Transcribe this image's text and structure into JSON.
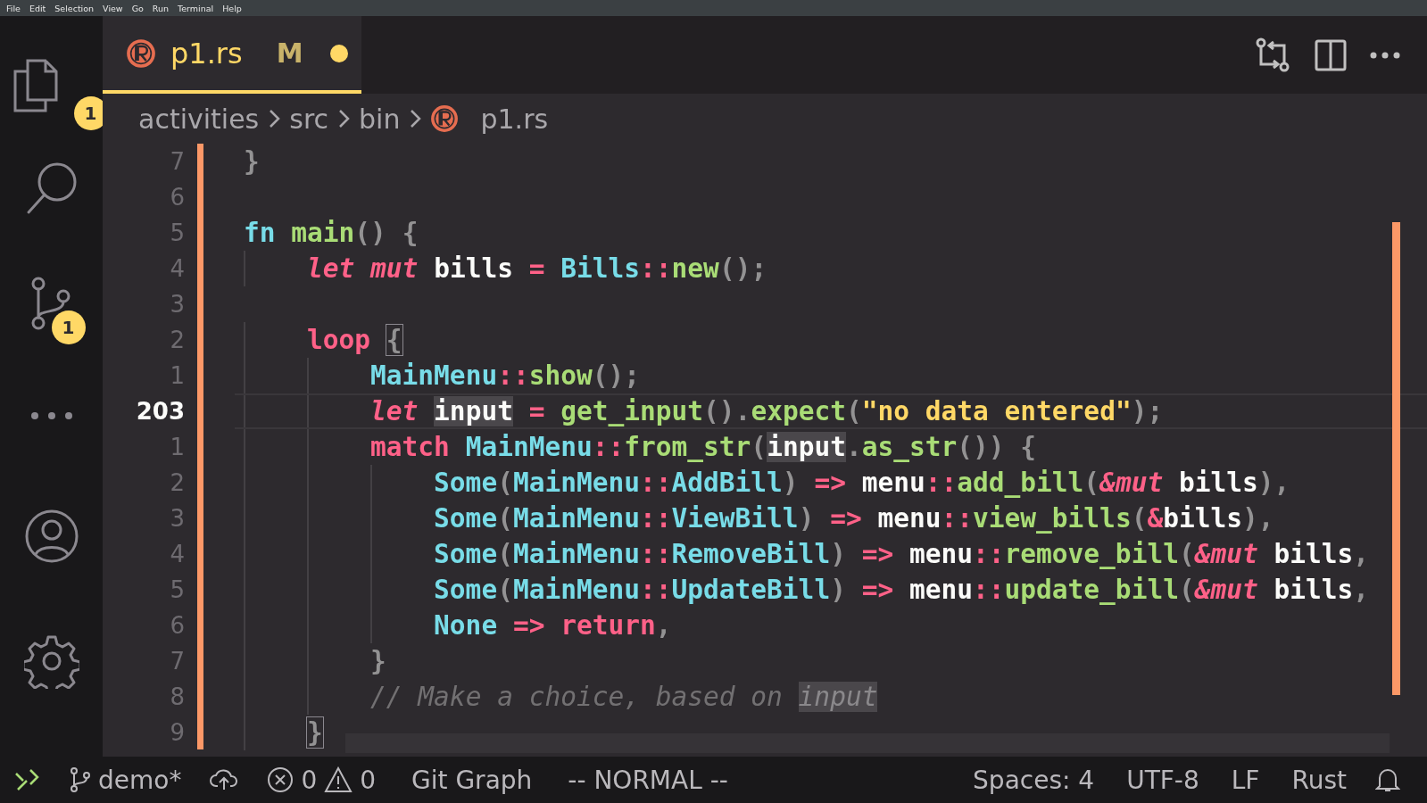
{
  "menu_bar": [
    "File",
    "Edit",
    "Selection",
    "View",
    "Go",
    "Run",
    "Terminal",
    "Help"
  ],
  "activity_bar": [
    {
      "kind": "files",
      "badge": "1",
      "selected": false
    },
    {
      "kind": "search",
      "selected": false
    },
    {
      "kind": "source-control",
      "badge": "1",
      "selected": false
    },
    {
      "kind": "more",
      "selected": false
    },
    {
      "kind": "account",
      "selected": false
    },
    {
      "kind": "settings",
      "selected": false
    }
  ],
  "tab": {
    "label": "p1.rs",
    "status": "M",
    "modified": true,
    "selected": true
  },
  "breadcrumbs": [
    {
      "label": "activities",
      "kind": "folder"
    },
    {
      "label": "src",
      "kind": "folder"
    },
    {
      "label": "bin",
      "kind": "folder"
    },
    {
      "label": "p1.rs",
      "kind": "rust"
    }
  ],
  "editor": {
    "lines": [
      {
        "number": "7",
        "current": false,
        "tokens": [
          {
            "text": "}",
            "kind": "punct"
          }
        ]
      },
      {
        "number": "6",
        "current": false
      },
      {
        "number": "5",
        "current": false,
        "tokens": [
          {
            "text": "fn ",
            "kind": "ty"
          },
          {
            "text": "main",
            "kind": "fn"
          },
          {
            "text": "() {",
            "kind": "punct"
          }
        ]
      },
      {
        "number": "4",
        "current": false,
        "tokens": [
          {
            "text": "    let mut ",
            "kind": "kwi"
          },
          {
            "text": "bills ",
            "kind": "id"
          },
          {
            "text": "= ",
            "kind": "op"
          },
          {
            "text": "Bills",
            "kind": "ty"
          },
          {
            "text": "::",
            "kind": "op"
          },
          {
            "text": "new",
            "kind": "fn"
          },
          {
            "text": "();",
            "kind": "punct"
          }
        ]
      },
      {
        "number": "3",
        "current": false
      },
      {
        "number": "2",
        "current": false,
        "tokens": [
          {
            "text": "    loop ",
            "kind": "kw"
          },
          {
            "text": "{",
            "kind": "bracket"
          }
        ]
      },
      {
        "number": "1",
        "current": false,
        "tokens": [
          {
            "text": "        MainMenu",
            "kind": "ty"
          },
          {
            "text": "::",
            "kind": "op"
          },
          {
            "text": "show",
            "kind": "fn"
          },
          {
            "text": "();",
            "kind": "punct"
          }
        ]
      },
      {
        "number": "203",
        "current": true,
        "tokens": [
          {
            "text": "        let ",
            "kind": "kwi"
          },
          {
            "text": "input",
            "kind": "hl"
          },
          {
            "text": " = ",
            "kind": "op"
          },
          {
            "text": "get_input",
            "kind": "fn"
          },
          {
            "text": "().",
            "kind": "punct"
          },
          {
            "text": "expect",
            "kind": "fn"
          },
          {
            "text": "(",
            "kind": "punct"
          },
          {
            "text": "\"no data entered\"",
            "kind": "str"
          },
          {
            "text": ");",
            "kind": "punct"
          }
        ]
      },
      {
        "number": "1",
        "current": false,
        "tokens": [
          {
            "text": "        match ",
            "kind": "kw"
          },
          {
            "text": "MainMenu",
            "kind": "ty"
          },
          {
            "text": "::",
            "kind": "op"
          },
          {
            "text": "from_str",
            "kind": "fn"
          },
          {
            "text": "(",
            "kind": "punct"
          },
          {
            "text": "input",
            "kind": "hl"
          },
          {
            "text": ".",
            "kind": "punct"
          },
          {
            "text": "as_str",
            "kind": "fn"
          },
          {
            "text": "()) {",
            "kind": "punct"
          }
        ]
      },
      {
        "number": "2",
        "current": false,
        "tokens": [
          {
            "text": "            Some",
            "kind": "ty"
          },
          {
            "text": "(",
            "kind": "punct"
          },
          {
            "text": "MainMenu",
            "kind": "ty"
          },
          {
            "text": "::",
            "kind": "op"
          },
          {
            "text": "AddBill",
            "kind": "ty"
          },
          {
            "text": ") ",
            "kind": "punct"
          },
          {
            "text": "=> ",
            "kind": "op"
          },
          {
            "text": "menu",
            "kind": "id"
          },
          {
            "text": "::",
            "kind": "op"
          },
          {
            "text": "add_bill",
            "kind": "fn"
          },
          {
            "text": "(",
            "kind": "punct"
          },
          {
            "text": "&mut ",
            "kind": "kwi"
          },
          {
            "text": "bills",
            "kind": "id"
          },
          {
            "text": "),",
            "kind": "punct"
          }
        ]
      },
      {
        "number": "3",
        "current": false,
        "tokens": [
          {
            "text": "            Some",
            "kind": "ty"
          },
          {
            "text": "(",
            "kind": "punct"
          },
          {
            "text": "MainMenu",
            "kind": "ty"
          },
          {
            "text": "::",
            "kind": "op"
          },
          {
            "text": "ViewBill",
            "kind": "ty"
          },
          {
            "text": ") ",
            "kind": "punct"
          },
          {
            "text": "=> ",
            "kind": "op"
          },
          {
            "text": "menu",
            "kind": "id"
          },
          {
            "text": "::",
            "kind": "op"
          },
          {
            "text": "view_bills",
            "kind": "fn"
          },
          {
            "text": "(",
            "kind": "punct"
          },
          {
            "text": "&",
            "kind": "op"
          },
          {
            "text": "bills",
            "kind": "id"
          },
          {
            "text": "),",
            "kind": "punct"
          }
        ]
      },
      {
        "number": "4",
        "current": false,
        "tokens": [
          {
            "text": "            Some",
            "kind": "ty"
          },
          {
            "text": "(",
            "kind": "punct"
          },
          {
            "text": "MainMenu",
            "kind": "ty"
          },
          {
            "text": "::",
            "kind": "op"
          },
          {
            "text": "RemoveBill",
            "kind": "ty"
          },
          {
            "text": ") ",
            "kind": "punct"
          },
          {
            "text": "=> ",
            "kind": "op"
          },
          {
            "text": "menu",
            "kind": "id"
          },
          {
            "text": "::",
            "kind": "op"
          },
          {
            "text": "remove_bill",
            "kind": "fn"
          },
          {
            "text": "(",
            "kind": "punct"
          },
          {
            "text": "&mut ",
            "kind": "kwi"
          },
          {
            "text": "bills",
            "kind": "id"
          },
          {
            "text": ",",
            "kind": "punct"
          }
        ]
      },
      {
        "number": "5",
        "current": false,
        "tokens": [
          {
            "text": "            Some",
            "kind": "ty"
          },
          {
            "text": "(",
            "kind": "punct"
          },
          {
            "text": "MainMenu",
            "kind": "ty"
          },
          {
            "text": "::",
            "kind": "op"
          },
          {
            "text": "UpdateBill",
            "kind": "ty"
          },
          {
            "text": ") ",
            "kind": "punct"
          },
          {
            "text": "=> ",
            "kind": "op"
          },
          {
            "text": "menu",
            "kind": "id"
          },
          {
            "text": "::",
            "kind": "op"
          },
          {
            "text": "update_bill",
            "kind": "fn"
          },
          {
            "text": "(",
            "kind": "punct"
          },
          {
            "text": "&mut ",
            "kind": "kwi"
          },
          {
            "text": "bills",
            "kind": "id"
          },
          {
            "text": ",",
            "kind": "punct"
          }
        ]
      },
      {
        "number": "6",
        "current": false,
        "tokens": [
          {
            "text": "            None ",
            "kind": "ty"
          },
          {
            "text": "=> ",
            "kind": "op"
          },
          {
            "text": "return",
            "kind": "kw"
          },
          {
            "text": ",",
            "kind": "punct"
          }
        ]
      },
      {
        "number": "7",
        "current": false,
        "tokens": [
          {
            "text": "        }",
            "kind": "punct"
          }
        ]
      },
      {
        "number": "8",
        "current": false,
        "tokens": [
          {
            "text": "        // Make a choice, based on ",
            "kind": "cmt"
          },
          {
            "text": "input",
            "kind": "cmthl"
          }
        ]
      },
      {
        "number": "9",
        "current": false,
        "tokens": [
          {
            "text": "    }",
            "kind": "bracket"
          }
        ]
      }
    ]
  },
  "status_bar": {
    "branch": "demo*",
    "errors": "0",
    "warnings": "0",
    "items_left": [
      "Git Graph",
      "-- NORMAL --"
    ],
    "items_right": [
      "Spaces: 4",
      "UTF-8",
      "LF",
      "Rust"
    ]
  }
}
